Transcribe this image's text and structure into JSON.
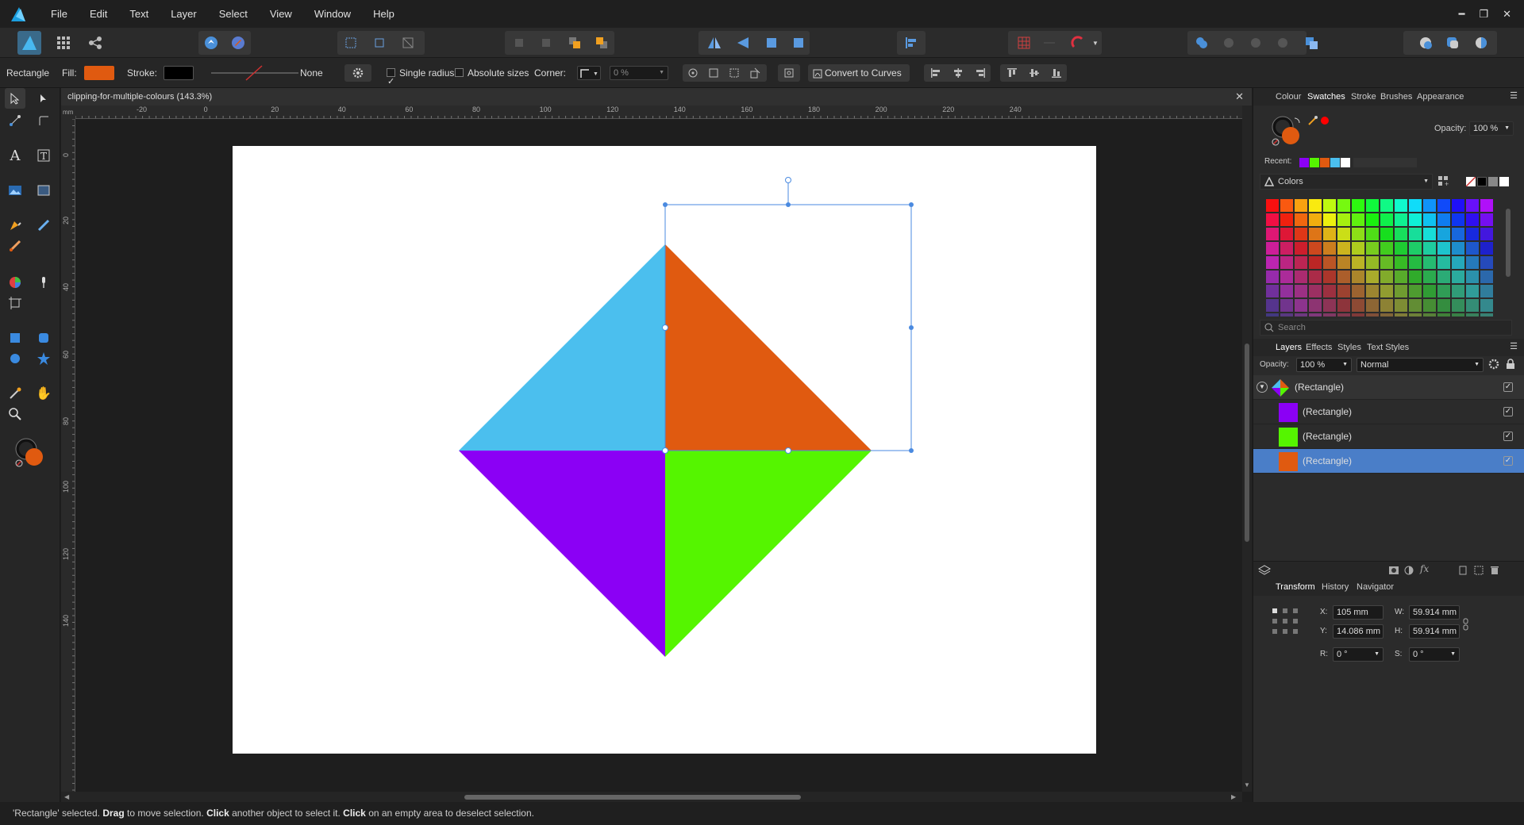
{
  "menu": [
    "File",
    "Edit",
    "Text",
    "Layer",
    "Select",
    "View",
    "Window",
    "Help"
  ],
  "context": {
    "tool_name": "Rectangle",
    "fill_label": "Fill:",
    "fill_color": "#e05a10",
    "stroke_label": "Stroke:",
    "stroke_color": "#000000",
    "stroke_style": "None",
    "single_radius": "Single radius",
    "absolute_sizes": "Absolute sizes",
    "corner_label": "Corner:",
    "corner_value": "0 %",
    "convert_label": "Convert to Curves"
  },
  "document": {
    "tab_title": "clipping-for-multiple-colours (143.3%)",
    "ruler_unit": "mm",
    "h_ruler_labels": [
      "-20",
      "0",
      "20",
      "40",
      "60",
      "80",
      "100",
      "120",
      "140",
      "160",
      "180",
      "200",
      "220",
      "240"
    ],
    "v_ruler_labels": [
      "0",
      "20",
      "40",
      "60",
      "80",
      "100",
      "120",
      "140"
    ]
  },
  "artwork": {
    "colors": {
      "top_left": "#4bbfee",
      "top_right": "#e05a10",
      "bottom_left": "#8b00f5",
      "bottom_right": "#55f500"
    }
  },
  "panels": {
    "top_tabs": [
      "Colour",
      "Swatches",
      "Stroke",
      "Brushes",
      "Appearance"
    ],
    "opacity_label": "Opacity:",
    "opacity_value": "100 %",
    "recent_label": "Recent:",
    "recent_colors": [
      "#8b00f5",
      "#55f500",
      "#e05a10",
      "#4bbfee",
      "#ffffff"
    ],
    "palette_name": "Colors",
    "search_placeholder": "Search",
    "layers_tabs": [
      "Layers",
      "Effects",
      "Styles",
      "Text Styles"
    ],
    "layers_opacity_label": "Opacity:",
    "layers_opacity": "100 %",
    "blend_mode": "Normal",
    "layers": [
      {
        "name": "(Rectangle)",
        "color": "#e05a10",
        "type": "group",
        "selected": false
      },
      {
        "name": "(Rectangle)",
        "color": "#8b00f5",
        "type": "child",
        "selected": false
      },
      {
        "name": "(Rectangle)",
        "color": "#55f500",
        "type": "child",
        "selected": false
      },
      {
        "name": "(Rectangle)",
        "color": "#e05a10",
        "type": "child",
        "selected": true
      }
    ],
    "transform_tabs": [
      "Transform",
      "History",
      "Navigator"
    ],
    "transform": {
      "x_label": "X:",
      "x": "105 mm",
      "y_label": "Y:",
      "y": "14.086 mm",
      "w_label": "W:",
      "w": "59.914 mm",
      "h_label": "H:",
      "h": "59.914 mm",
      "r_label": "R:",
      "r": "0 °",
      "s_label": "S:",
      "s": "0 °"
    }
  },
  "status": {
    "part1": "'Rectangle' selected. ",
    "b1": "Drag",
    "part2": " to move selection. ",
    "b2": "Click",
    "part3": " another object to select it. ",
    "b3": "Click",
    "part4": " on an empty area to deselect selection."
  }
}
